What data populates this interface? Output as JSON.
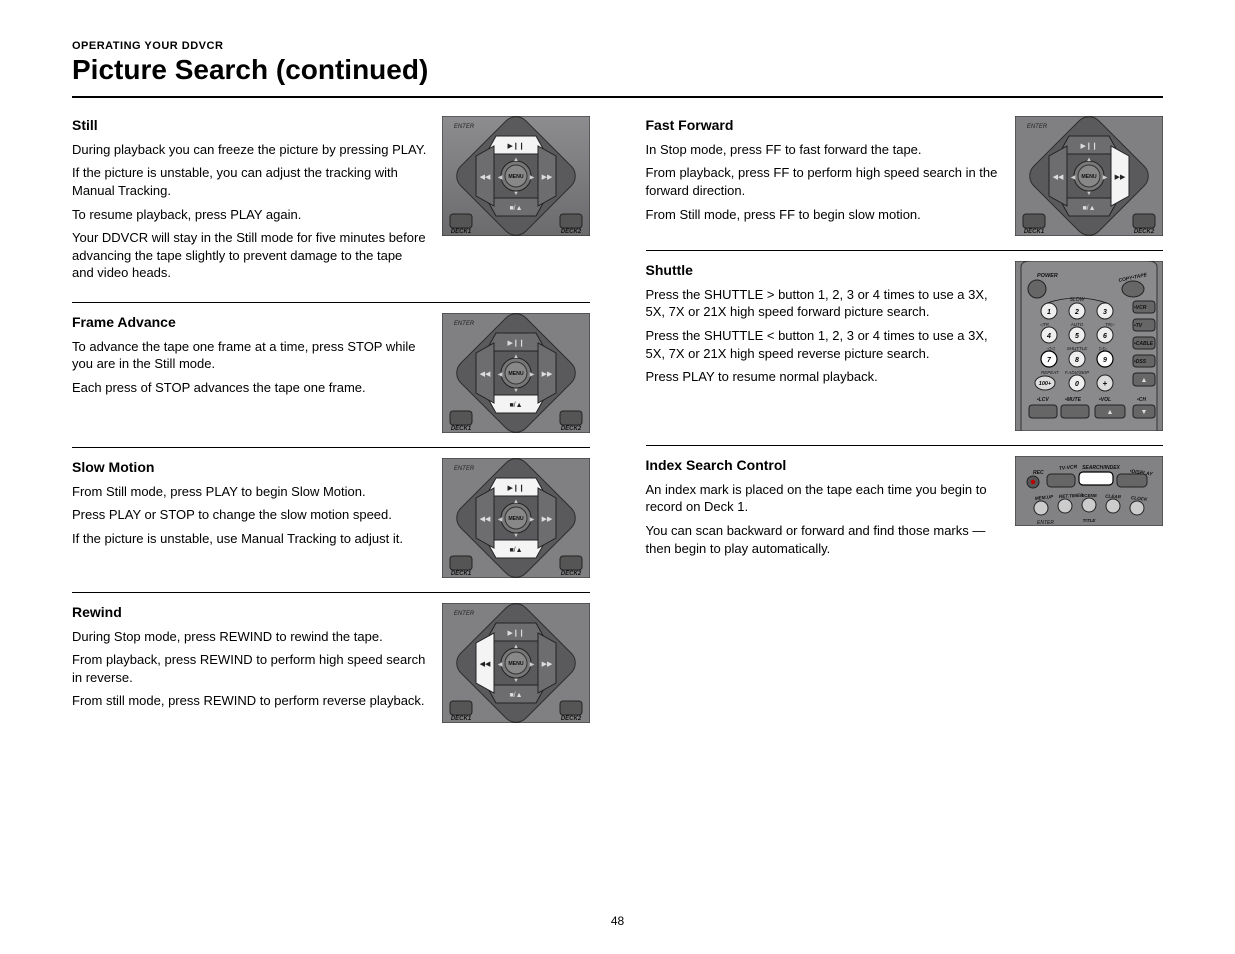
{
  "header": {
    "section_label": "OPERATING YOUR DDVCR",
    "page_title": "Picture Search (continued)"
  },
  "page_number": "48",
  "col1": {
    "still": {
      "heading": "Still",
      "p1": "During playback you can freeze the picture by pressing PLAY.",
      "p2": "If the picture is unstable, you can adjust the tracking with Manual Tracking.",
      "p3": "To resume playback, press PLAY again.",
      "p4": "Your DDVCR will stay in the Still mode for five minutes before advancing the tape slightly to prevent damage to the tape and video heads."
    },
    "frame": {
      "heading": "Frame Advance",
      "p1": "To advance the tape one frame at a time, press STOP while you are in the Still mode.",
      "p2": "Each press of STOP advances the tape one frame."
    },
    "slow": {
      "heading": "Slow Motion",
      "p1": "From Still mode, press PLAY to begin Slow Motion.",
      "p2": "Press PLAY or STOP to change the slow motion speed.",
      "p3": "If the picture is unstable, use Manual Tracking to adjust it."
    },
    "rewind": {
      "heading": "Rewind",
      "p1": "During Stop mode, press REWIND to rewind the tape.",
      "p2": "From playback, press REWIND to perform high speed search in reverse.",
      "p3": "From still mode, press REWIND to perform reverse playback."
    }
  },
  "col2": {
    "ff": {
      "heading": "Fast Forward",
      "p1": "In Stop mode, press FF to fast forward the tape.",
      "p2": "From playback, press FF to perform high speed search in the forward direction.",
      "p3": "From Still mode, press FF to begin slow motion."
    },
    "shuttle": {
      "heading": "Shuttle",
      "p1": "Press the SHUTTLE > button 1, 2, 3 or 4 times to use a 3X, 5X, 7X or 21X high speed forward picture search.",
      "p2": "Press the SHUTTLE < button 1, 2, 3 or 4 times to use a 3X, 5X, 7X or 21X high speed reverse picture search.",
      "p3": "Press PLAY to resume normal playback."
    },
    "index": {
      "heading": "Index Search Control",
      "p1": "An index mark is placed on the tape each time you begin to record on Deck 1.",
      "p2": "You can scan backward or forward and find those marks — then begin to play automatically."
    }
  },
  "remote": {
    "deck1": "DECK1",
    "deck2": "DECK2",
    "enter": "ENTER",
    "menu": "MENU",
    "power": "POWER",
    "copytape": "COPY•TAPE",
    "slow": "SLOW",
    "auto": "AUTO",
    "tr": "TR",
    "shuttle": "SHUTTLE",
    "repeat": "REPEAT",
    "fadvskip": "F.ADV/SKIP",
    "vcr": "•VCR",
    "tv": "•TV",
    "cable": "•CABLE",
    "dss": "•DSS",
    "lcv": "•LCV",
    "mute": "•MUTE",
    "vol": "•VOL",
    "ch": "•CH",
    "nums": [
      "1",
      "2",
      "3",
      "4",
      "5",
      "6",
      "7",
      "8",
      "9",
      "0"
    ],
    "hundred": "100+",
    "plus": "+",
    "tvvcr": "TV-VCR",
    "searchindex": "SEARCH/INDEX",
    "display": "•DISPLAY",
    "rec": "REC",
    "memup": "MEM.UP",
    "rettimer": "RET.TIMER",
    "scene": "SCENE",
    "clear": "CLEAR",
    "clock": "CLOCK",
    "title": "TITLE"
  }
}
